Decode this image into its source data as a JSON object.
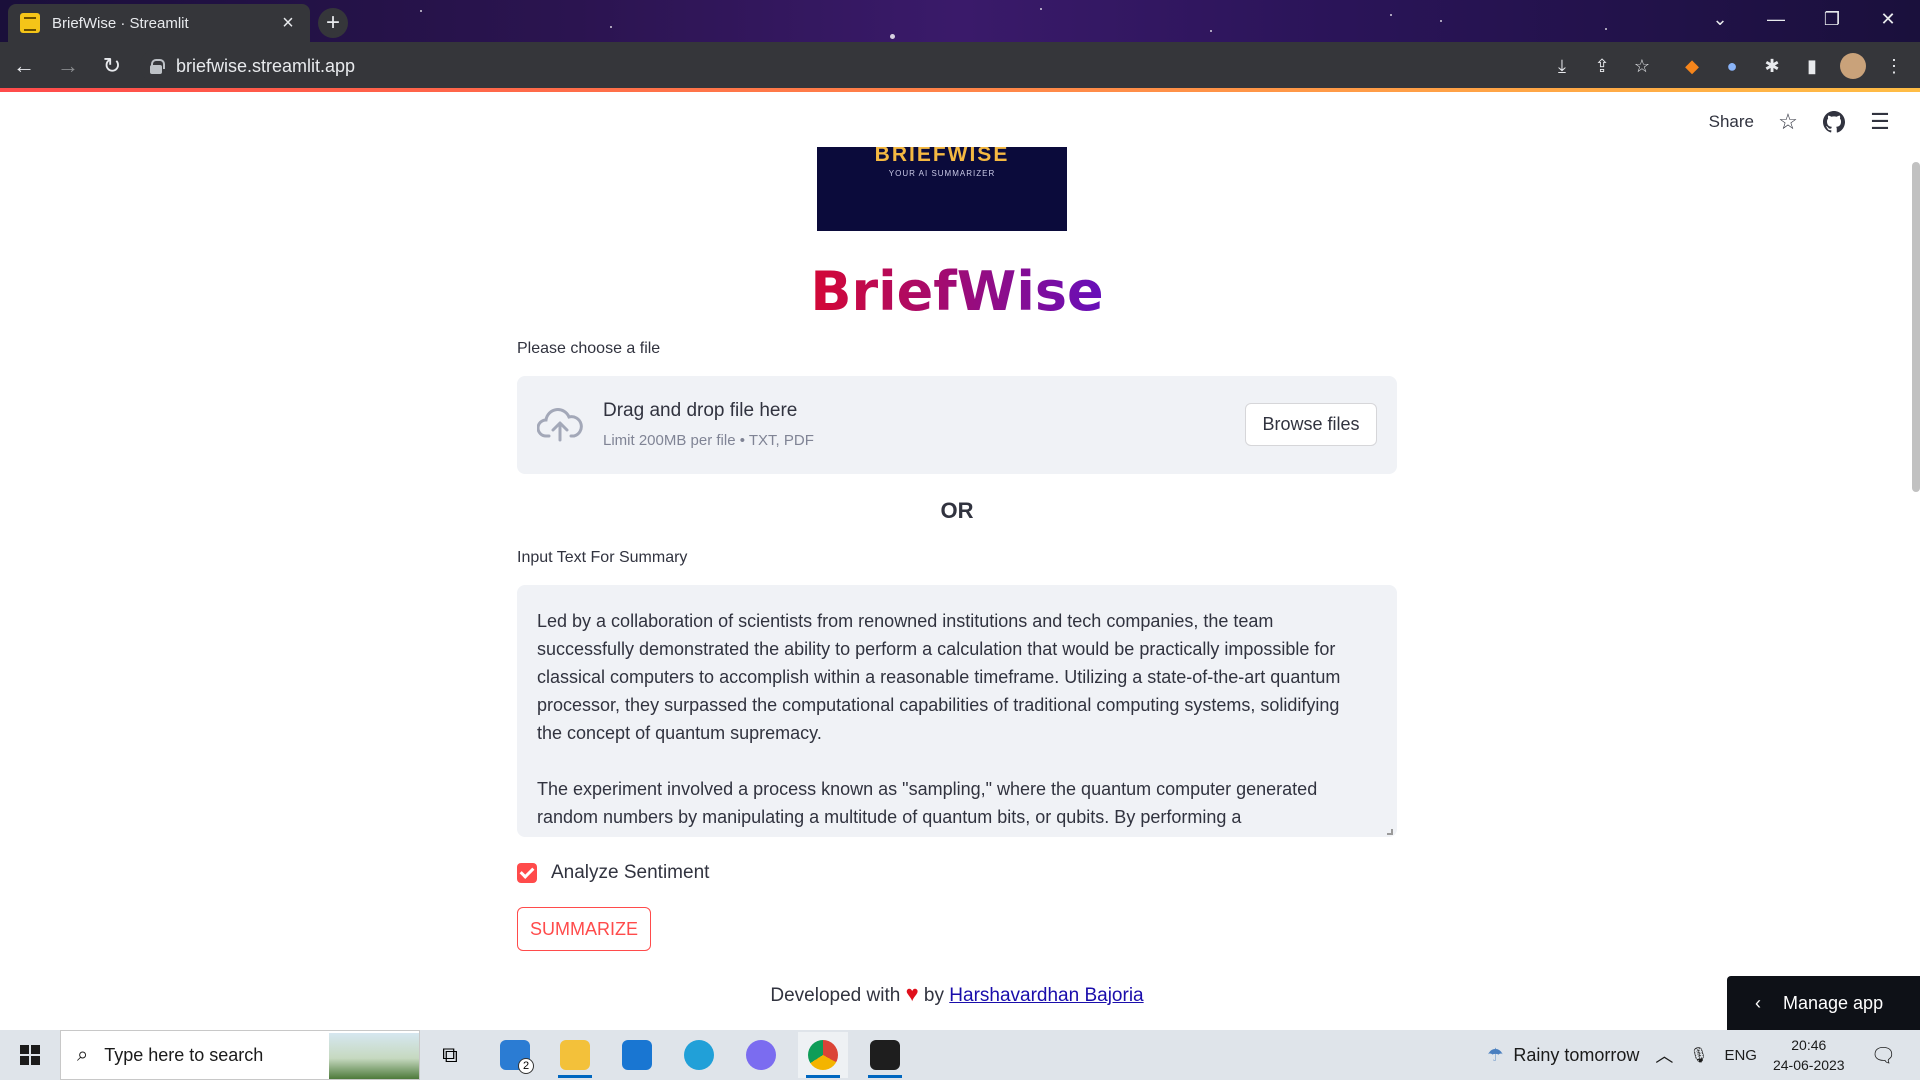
{
  "browser": {
    "tab_title": "BriefWise · Streamlit",
    "url": "briefwise.streamlit.app",
    "new_tab_label": "+"
  },
  "header": {
    "share_label": "Share",
    "icons": [
      "star-icon",
      "github-icon",
      "hamburger-menu-icon"
    ]
  },
  "banner": {
    "title": "BRIEFWISE",
    "subtitle": "YOUR AI SUMMARIZER"
  },
  "app_title": "BriefWise",
  "uploader": {
    "label": "Please choose a file",
    "drag_text": "Drag and drop file here",
    "limit_text": "Limit 200MB per file • TXT, PDF",
    "browse_label": "Browse files"
  },
  "or_label": "OR",
  "text_input": {
    "label": "Input Text For Summary",
    "paragraph1": "Led by a collaboration of scientists from renowned institutions and tech companies, the team successfully demonstrated the ability to perform a calculation that would be practically impossible for classical computers to accomplish within a reasonable timeframe. Utilizing a state-of-the-art quantum processor, they surpassed the computational capabilities of traditional computing systems, solidifying the concept of quantum supremacy.",
    "paragraph2": "The experiment involved a process known as \"sampling,\" where the quantum computer generated random numbers by manipulating a multitude of quantum bits, or qubits. By performing a"
  },
  "sentiment": {
    "label": "Analyze Sentiment",
    "checked": true
  },
  "summarize_label": "SUMMARIZE",
  "footer": {
    "prefix": "Developed with",
    "by": "by",
    "author": "Harshavardhan Bajoria"
  },
  "manage_app_label": "Manage app",
  "taskbar": {
    "search_placeholder": "Type here to search",
    "mail_badge": "2",
    "weather": "Rainy tomorrow",
    "language": "ENG",
    "time": "20:46",
    "date": "24-06-2023"
  },
  "colors": {
    "accent": "#ff4b4b",
    "title_gradient_start": "#e8001f",
    "title_gradient_end": "#1a00e8"
  }
}
